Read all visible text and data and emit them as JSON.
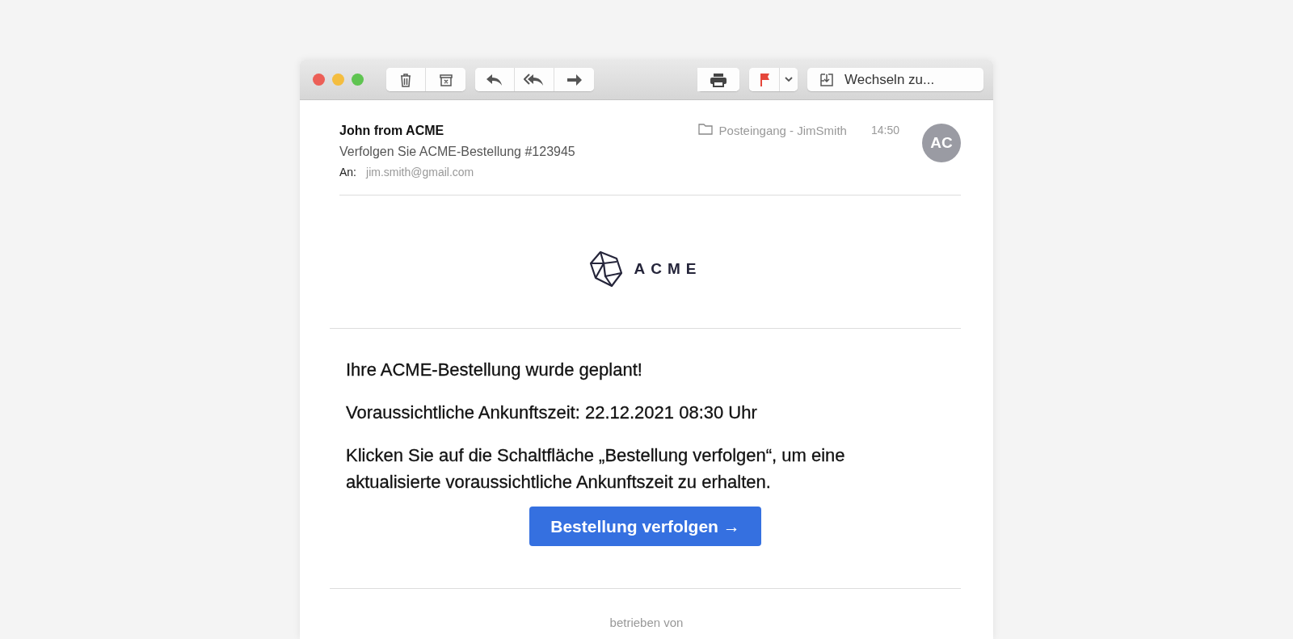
{
  "toolbar": {
    "mailbox_button": "Wechseln zu..."
  },
  "message": {
    "sender": "John from ACME",
    "subject": "Verfolgen Sie ACME-Bestellung #123945",
    "to_label": "An:",
    "to": "jim.smith@gmail.com",
    "folder": "Posteingang - JimSmith",
    "time": "14:50",
    "avatar": "AC"
  },
  "body": {
    "logo_text": "ACME",
    "heading": "Ihre ACME-Bestellung wurde geplant!",
    "eta": "Voraussichtliche Ankunftszeit: 22.12.2021 08:30 Uhr",
    "instructions": "Klicken Sie auf die Schaltfläche „Bestellung verfolgen“, um eine aktualisierte voraussichtliche Ankunftszeit zu erhalten.",
    "button": "Bestellung verfolgen →",
    "footer": "betrieben von"
  }
}
